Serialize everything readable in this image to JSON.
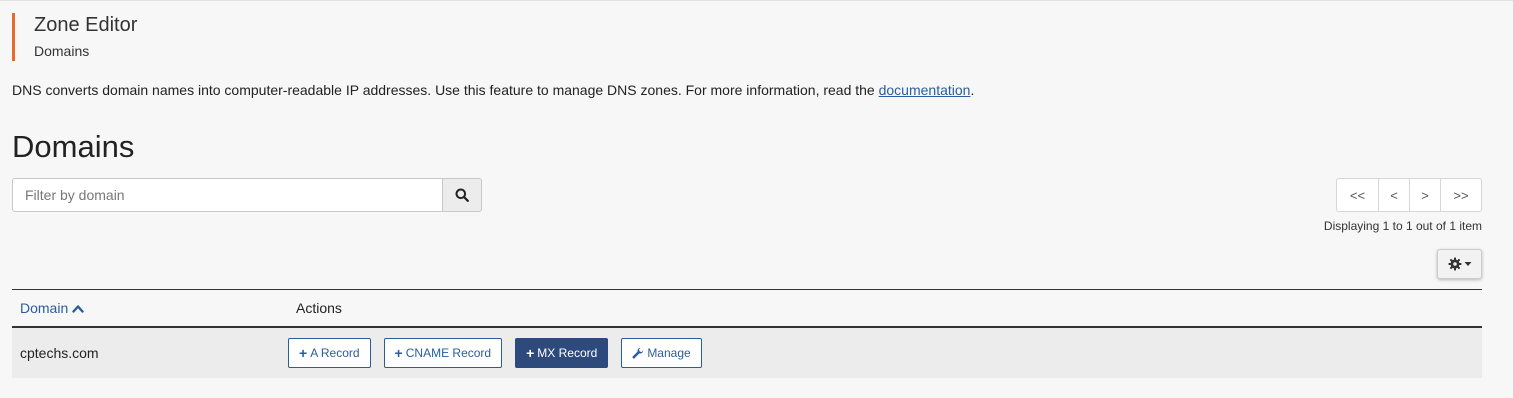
{
  "header": {
    "title": "Zone Editor",
    "subtitle": "Domains"
  },
  "description": {
    "text": "DNS converts domain names into computer-readable IP addresses. Use this feature to manage DNS zones. For more information, read the ",
    "link": "documentation",
    "suffix": "."
  },
  "section_title": "Domains",
  "search": {
    "placeholder": "Filter by domain",
    "value": "",
    "icon": "search-icon"
  },
  "pagination": {
    "first": "<<",
    "prev": "<",
    "next": ">",
    "last": ">>",
    "status": "Displaying 1 to 1 out of 1 item"
  },
  "settings": {
    "icon": "gear-icon"
  },
  "table": {
    "columns": [
      "Domain",
      "Actions"
    ],
    "sort_icon": "chevron-up-icon",
    "rows": [
      {
        "domain": "cptechs.com",
        "actions": [
          "A Record",
          "CNAME Record",
          "MX Record",
          "Manage"
        ]
      }
    ]
  },
  "colors": {
    "accent": "#e8692a",
    "link": "#2a5d9f",
    "primary_button": "#2e4a7d"
  }
}
